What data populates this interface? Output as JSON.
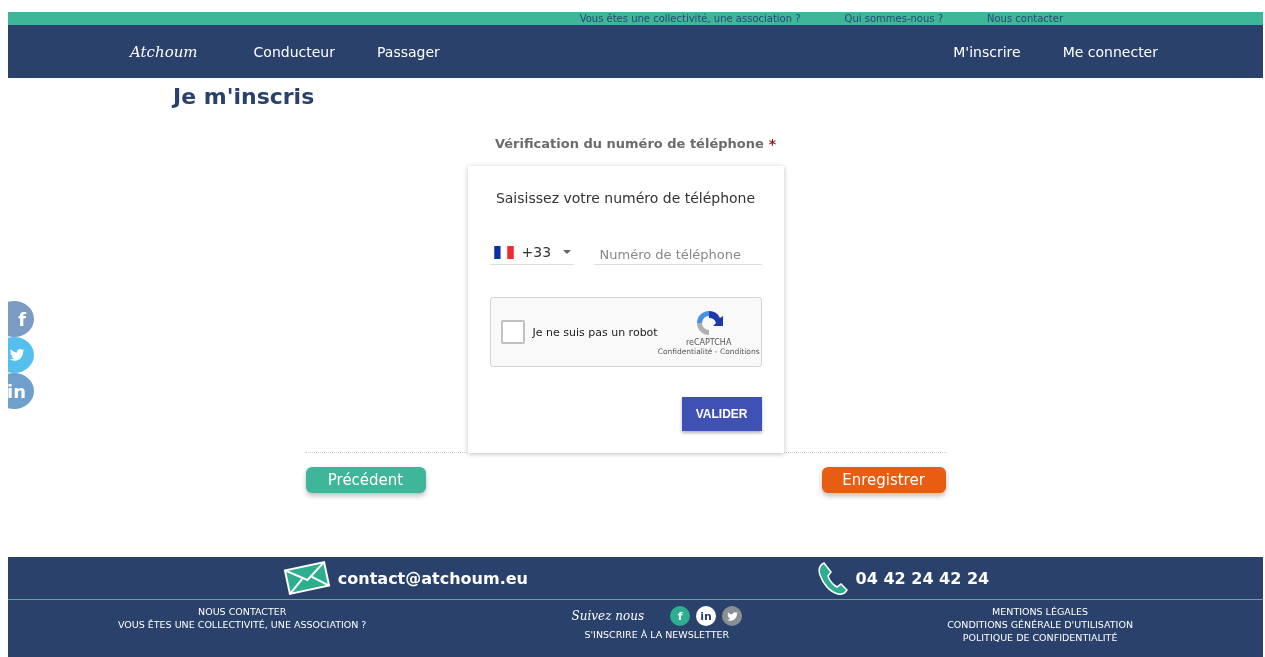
{
  "top_links": [
    "Vous êtes une collectivité, une association ?",
    "Qui sommes-nous ?",
    "Nous contacter"
  ],
  "nav": {
    "logo": "Atchoum",
    "left": [
      "Conducteur",
      "Passager"
    ],
    "right": [
      "M'inscrire",
      "Me connecter"
    ]
  },
  "page_title": "Je m'inscris",
  "section_label": "Vérification du numéro de téléphone",
  "required_mark": "*",
  "card": {
    "prompt": "Saisissez votre numéro de téléphone",
    "country_code": "+33",
    "phone_placeholder": "Numéro de téléphone",
    "captcha": {
      "label": "Je ne suis pas un robot",
      "checked": false,
      "brand": "reCAPTCHA",
      "terms": "Confidentialité - Conditions"
    },
    "submit": "VALIDER"
  },
  "social_side": [
    {
      "kind": "facebook",
      "glyph": "f"
    },
    {
      "kind": "twitter"
    },
    {
      "kind": "linkedin",
      "glyph": "in"
    }
  ],
  "prev_button": "Précédent",
  "next_button": "Enregistrer",
  "footer": {
    "email": "contact@atchoum.eu",
    "phone": "04 42 24 42 24",
    "left_links": [
      "NOUS CONTACTER",
      "VOUS ÊTES UNE COLLECTIVITÉ, UNE ASSOCIATION ?"
    ],
    "follow": "Suivez nous",
    "social": [
      {
        "kind": "facebook",
        "glyph": "f"
      },
      {
        "kind": "linkedin",
        "glyph": "in"
      },
      {
        "kind": "twitter"
      }
    ],
    "newsletter": "S'INSCRIRE À LA NEWSLETTER",
    "right_links": [
      "MENTIONS LÉGALES",
      "CONDITIONS GÉNÉRALE D'UTILISATION",
      "POLITIQUE DE CONFIDENTIALITÉ"
    ]
  }
}
